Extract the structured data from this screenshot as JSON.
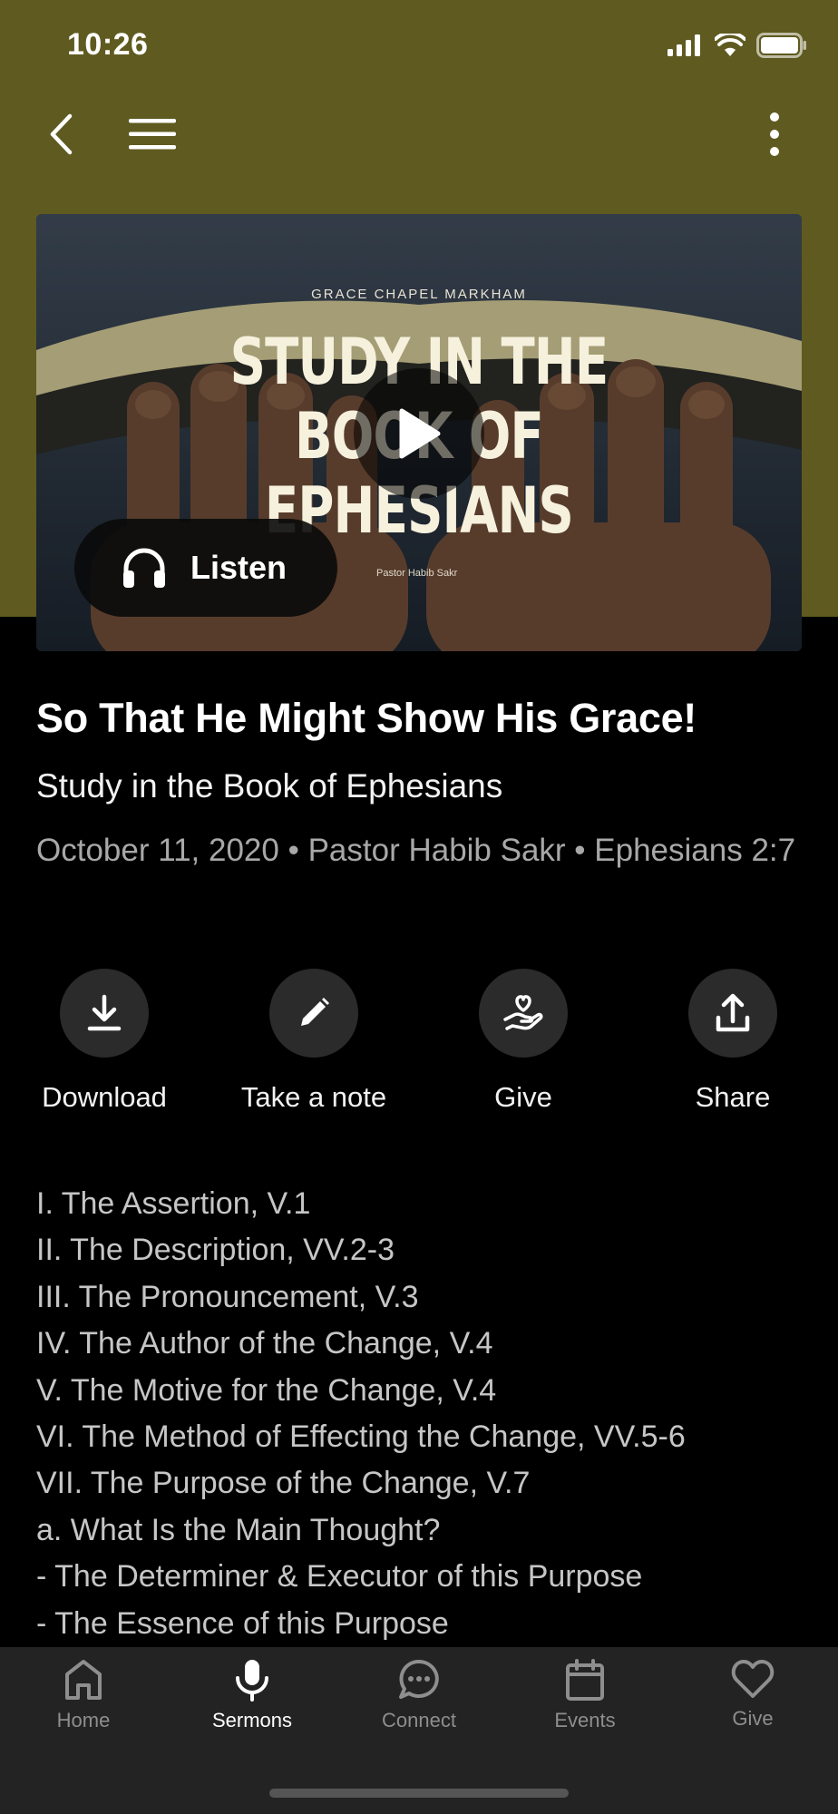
{
  "status_bar": {
    "time": "10:26"
  },
  "nav": {
    "back_icon": "chevron-left-icon",
    "menu_icon": "hamburger-icon",
    "more_icon": "more-vertical-icon"
  },
  "hero": {
    "church": "GRACE CHAPEL MARKHAM",
    "title_lines": [
      "STUDY IN THE",
      "BOOK OF",
      "EPHESIANS"
    ],
    "pastor": "Pastor Habib Sakr",
    "listen_label": "Listen"
  },
  "sermon": {
    "title": "So That He Might Show His Grace!",
    "series": "Study in the Book of Ephesians",
    "meta": "October 11, 2020 • Pastor Habib Sakr • Ephesians 2:7"
  },
  "actions": [
    {
      "label": "Download",
      "icon": "download-icon"
    },
    {
      "label": "Take a note",
      "icon": "pencil-icon"
    },
    {
      "label": "Give",
      "icon": "give-heart-hand-icon"
    },
    {
      "label": "Share",
      "icon": "share-icon"
    }
  ],
  "outline": [
    "I. The Assertion, V.1",
    "II. The Description, VV.2-3",
    "III. The Pronouncement, V.3",
    "IV. The Author of the Change, V.4",
    "V. The Motive for the Change, V.4",
    "VI. The Method of Effecting the Change, VV.5-6",
    "VII. The Purpose of the Change, V.7",
    "a. What Is the Main Thought?",
    "- The Determiner & Executor of this Purpose",
    "- The Essence of this Purpose"
  ],
  "tabs": [
    {
      "label": "Home",
      "icon": "home-icon",
      "active": false
    },
    {
      "label": "Sermons",
      "icon": "microphone-icon",
      "active": true
    },
    {
      "label": "Connect",
      "icon": "chat-bubble-icon",
      "active": false
    },
    {
      "label": "Events",
      "icon": "calendar-icon",
      "active": false
    },
    {
      "label": "Give",
      "icon": "heart-icon",
      "active": false
    }
  ],
  "colors": {
    "header_bg": "#5f5a20",
    "page_bg": "#000000",
    "tabbar_bg": "#232323",
    "muted_text": "#a8a8a8"
  }
}
